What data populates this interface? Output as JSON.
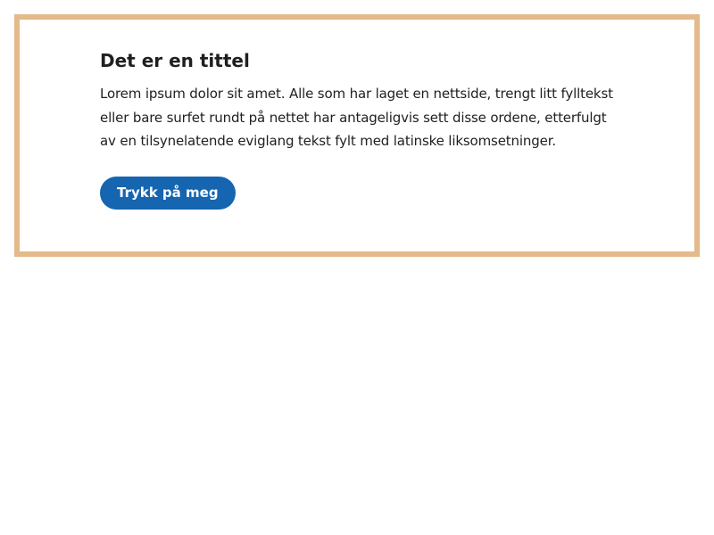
{
  "card": {
    "title": "Det er en tittel",
    "body": "Lorem ipsum dolor sit amet. Alle som har laget en nettside, trengt litt fylltekst eller bare surfet rundt på nettet har antageligvis sett disse ordene, etterfulgt av en tilsynelatende eviglang tekst fylt med latinske liksomsetninger.",
    "button_label": "Trykk på meg"
  },
  "colors": {
    "card_border": "#e5b98a",
    "button_background": "#1565b0",
    "button_text": "#ffffff",
    "text": "#1f1f1f"
  }
}
